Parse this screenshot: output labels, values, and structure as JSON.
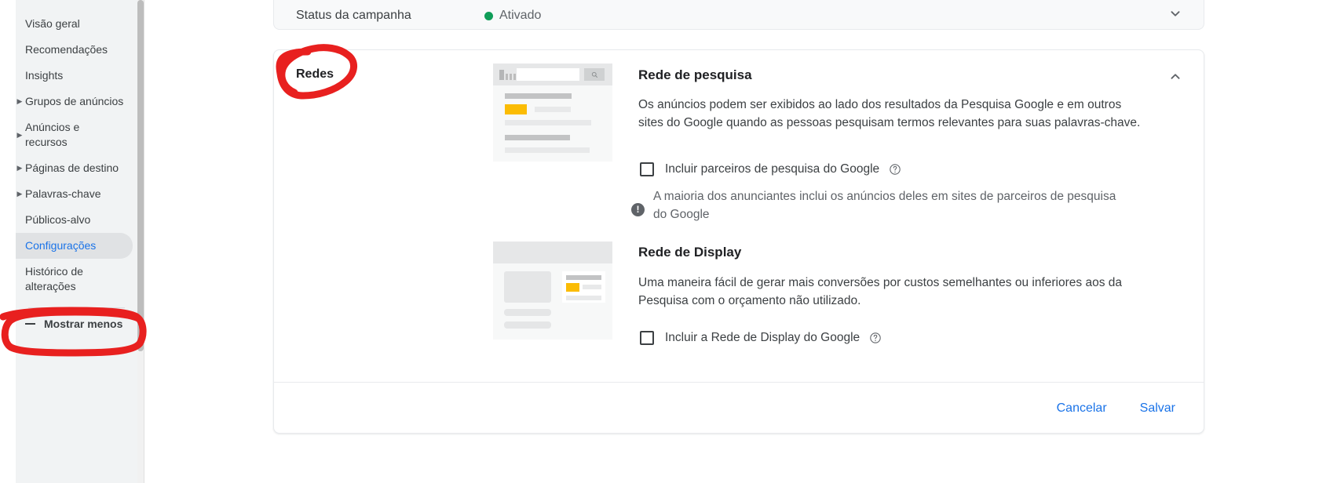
{
  "sidebar": {
    "items": [
      {
        "label": "Visão geral",
        "expandable": false,
        "selected": false
      },
      {
        "label": "Recomendações",
        "expandable": false,
        "selected": false
      },
      {
        "label": "Insights",
        "expandable": false,
        "selected": false
      },
      {
        "label": "Grupos de anúncios",
        "expandable": true,
        "selected": false
      },
      {
        "label": "Anúncios e\nrecursos",
        "expandable": true,
        "selected": false
      },
      {
        "label": "Páginas de destino",
        "expandable": true,
        "selected": false
      },
      {
        "label": "Palavras-chave",
        "expandable": true,
        "selected": false
      },
      {
        "label": "Públicos-alvo",
        "expandable": false,
        "selected": false
      },
      {
        "label": "Configurações",
        "expandable": false,
        "selected": true
      },
      {
        "label": "Histórico de\nalterações",
        "expandable": false,
        "selected": false
      }
    ],
    "show_less_label": "Mostrar menos"
  },
  "status_card": {
    "label": "Status da campanha",
    "value": "Ativado",
    "dot_color": "#0f9d58",
    "chevron": "chevron-down"
  },
  "networks_card": {
    "title": "Redes",
    "collapse_icon": "chevron-up",
    "search_network": {
      "heading": "Rede de pesquisa",
      "description": "Os anúncios podem ser exibidos ao lado dos resultados da Pesquisa Google e em outros sites do Google quando as pessoas pesquisam termos relevantes para suas palavras-chave.",
      "checkbox_label": "Incluir parceiros de pesquisa do Google",
      "checkbox_checked": false,
      "help_icon": "help-circle-icon",
      "note": "A maioria dos anunciantes inclui os anúncios deles em sites de parceiros de pesquisa do Google",
      "note_icon": "exclamation-circle-icon"
    },
    "display_network": {
      "heading": "Rede de Display",
      "description": "Uma maneira fácil de gerar mais conversões por custos semelhantes ou inferiores aos da Pesquisa com o orçamento não utilizado.",
      "checkbox_label": "Incluir a Rede de Display do Google",
      "checkbox_checked": false,
      "help_icon": "help-circle-icon"
    },
    "actions": {
      "cancel_label": "Cancelar",
      "save_label": "Salvar"
    }
  },
  "annotations": {
    "color": "#e8201f",
    "marks": [
      {
        "name": "redes-circle",
        "shape": "ellipse-scribble"
      },
      {
        "name": "configuracoes-circle",
        "shape": "rounded-rect-scribble"
      }
    ]
  },
  "colors": {
    "accent_blue": "#1a73e8",
    "green": "#0f9d58",
    "yellow": "#fbbc04",
    "annotation_red": "#e8201f",
    "sidebar_bg": "#f1f3f4",
    "selected_bg": "#e0e2e4"
  }
}
